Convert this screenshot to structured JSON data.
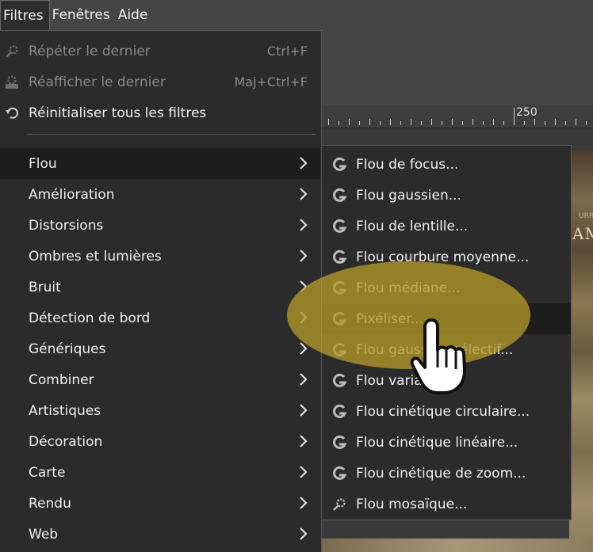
{
  "menubar": {
    "items": [
      {
        "label": "Filtres",
        "active": true
      },
      {
        "label": "Fenêtres",
        "active": false
      },
      {
        "label": "Aide",
        "active": false
      }
    ]
  },
  "ruler": {
    "label": "250"
  },
  "image_overlay": {
    "small_text": "URRY",
    "large_text": "AM"
  },
  "filters_menu": {
    "repeat": {
      "label": "Répéter le dernier",
      "shortcut": "Ctrl+F",
      "icon": "gear-filter-icon",
      "enabled": false
    },
    "reshow": {
      "label": "Réafficher le dernier",
      "shortcut": "Maj+Ctrl+F",
      "icon": "gear-dialog-icon",
      "enabled": false
    },
    "reset": {
      "label": "Réinitialiser tous les filtres",
      "icon": "reset-icon",
      "enabled": true
    },
    "categories": [
      {
        "label": "Flou",
        "highlighted": true
      },
      {
        "label": "Amélioration"
      },
      {
        "label": "Distorsions"
      },
      {
        "label": "Ombres et lumières"
      },
      {
        "label": "Bruit"
      },
      {
        "label": "Détection de bord"
      },
      {
        "label": "Génériques"
      },
      {
        "label": "Combiner"
      },
      {
        "label": "Artistiques"
      },
      {
        "label": "Décoration"
      },
      {
        "label": "Carte"
      },
      {
        "label": "Rendu"
      },
      {
        "label": "Web"
      }
    ]
  },
  "blur_submenu": {
    "items": [
      {
        "label": "Flou de focus...",
        "icon": "gegl-g-icon"
      },
      {
        "label": "Flou gaussien...",
        "icon": "gegl-g-icon"
      },
      {
        "label": "Flou de lentille...",
        "icon": "gegl-g-icon"
      },
      {
        "label": "Flou courbure moyenne...",
        "icon": "gegl-g-icon"
      },
      {
        "label": "Flou médiane...",
        "icon": "gegl-g-icon"
      },
      {
        "label": "Pixéliser...",
        "icon": "gegl-g-icon",
        "highlighted": true
      },
      {
        "label": "Flou gaussien sélectif...",
        "icon": "gegl-g-icon"
      },
      {
        "label": "Flou variable...",
        "icon": "gegl-g-icon"
      },
      {
        "label": "Flou cinétique circulaire...",
        "icon": "gegl-g-icon"
      },
      {
        "label": "Flou cinétique linéaire...",
        "icon": "gegl-g-icon"
      },
      {
        "label": "Flou cinétique de zoom...",
        "icon": "gegl-g-icon"
      },
      {
        "label": "Flou mosaïque...",
        "icon": "gear-filter-icon"
      }
    ]
  },
  "colors": {
    "menu_bg": "#2b2b2b",
    "highlight_bg": "#1d1d1d",
    "glow": "#b29828",
    "text": "#f0f0f0",
    "disabled_text": "#8a8a8a"
  }
}
